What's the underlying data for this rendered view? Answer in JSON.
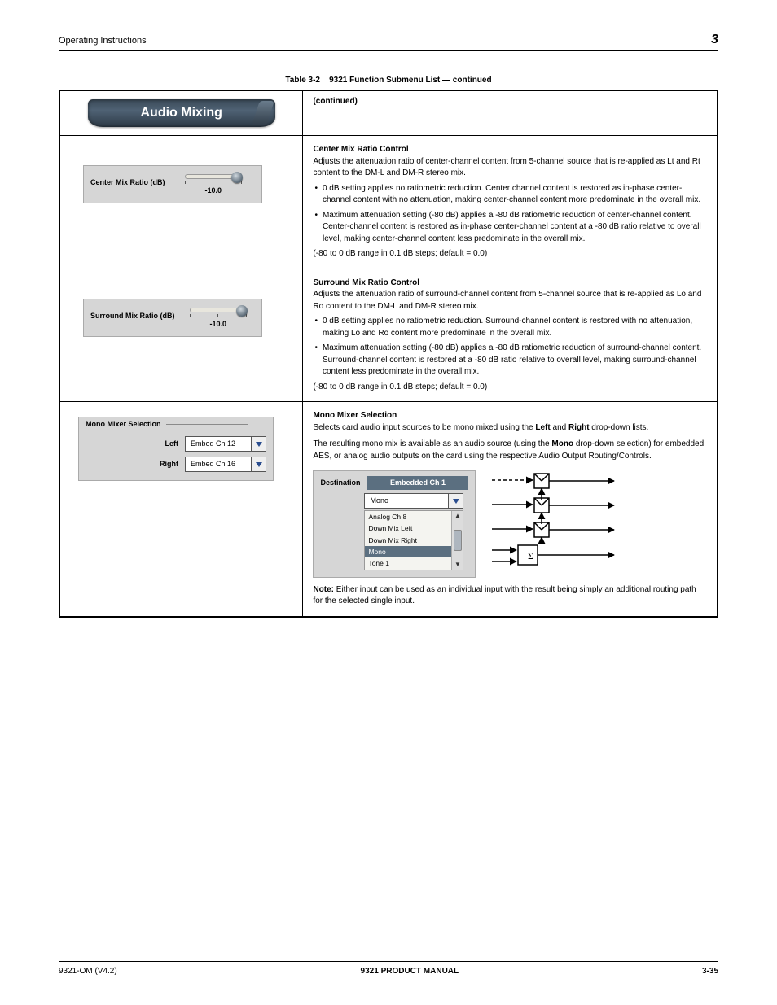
{
  "header": {
    "left": "Operating Instructions",
    "right": "3"
  },
  "table_caption": {
    "prefix": "Table 3-2",
    "title": "9321 Function Submenu List — continued"
  },
  "tab_title": "Audio Mixing",
  "tab_continued": "(continued)",
  "center_mix": {
    "label": "Center Mix Ratio (dB)",
    "value": "-10.0",
    "desc_head": "Center Mix Ratio Control",
    "desc_body": "Adjusts the attenuation ratio of center-channel content from 5-channel source that is re-applied as Lt and Rt content to the DM-L and DM-R stereo mix.",
    "bullets": [
      "0 dB setting applies no ratiometric reduction. Center channel content is restored as in-phase center-channel content with no attenuation, making center-channel content more predominate in the overall mix.",
      "Maximum attenuation setting (-80 dB) applies a -80 dB ratiometric reduction of center-channel content. Center-channel content is restored as in-phase center-channel content at a -80 dB ratio relative to overall level, making center-channel content less predominate in the overall mix."
    ],
    "range": "(-80 to 0 dB range in 0.1 dB steps; default = 0.0)"
  },
  "surround_mix": {
    "label": "Surround Mix Ratio (dB)",
    "value": "-10.0",
    "desc_head": "Surround Mix Ratio Control",
    "desc_body": "Adjusts the attenuation ratio of surround-channel content from 5-channel source that is re-applied as Lo and Ro content to the DM-L and DM-R stereo mix.",
    "bullets": [
      "0 dB setting applies no ratiometric reduction. Surround-channel content is restored with no attenuation, making Lo and Ro content more predominate in the overall mix.",
      "Maximum attenuation setting (-80 dB) applies a -80 dB ratiometric reduction of surround-channel content. Surround-channel content is restored at a -80 dB ratio relative to overall level, making surround-channel content less predominate in the overall mix."
    ],
    "range": "(-80 to 0 dB range in 0.1 dB steps; default = 0.0)"
  },
  "mono_mixer": {
    "group_title": "Mono Mixer Selection",
    "left_label": "Left",
    "left_value": "Embed Ch 12",
    "right_label": "Right",
    "right_value": "Embed Ch 16",
    "desc_head": "Mono Mixer Selection",
    "desc_body_1": "Selects card audio input sources to be mono mixed using the ",
    "desc_body_strong": "Left",
    "desc_body_2": " and ",
    "desc_body_strong2": "Right",
    "desc_body_3": " drop-down lists.",
    "desc_para2_1": "The resulting mono mix is available as an audio source (using the ",
    "desc_para2_strong": "Mono",
    "desc_para2_2": " drop-down selection) for embedded, AES, or analog audio outputs on the card using the respective Audio Output Routing/Controls.",
    "destination": {
      "label": "Destination",
      "title": "Embedded Ch 1",
      "selected": "Mono",
      "options": [
        "Analog Ch 8",
        "Down Mix Left",
        "Down Mix Right",
        "Mono",
        "Tone 1"
      ],
      "options_selected": "Mono"
    },
    "note_strong": "Note:",
    "note_body": " Either input can be used as an individual input with the result being simply an additional routing path for the selected single input."
  },
  "footer": {
    "left": "9321-OM (V4.2)",
    "mid": "9321 PRODUCT MANUAL",
    "right": "3-35"
  }
}
